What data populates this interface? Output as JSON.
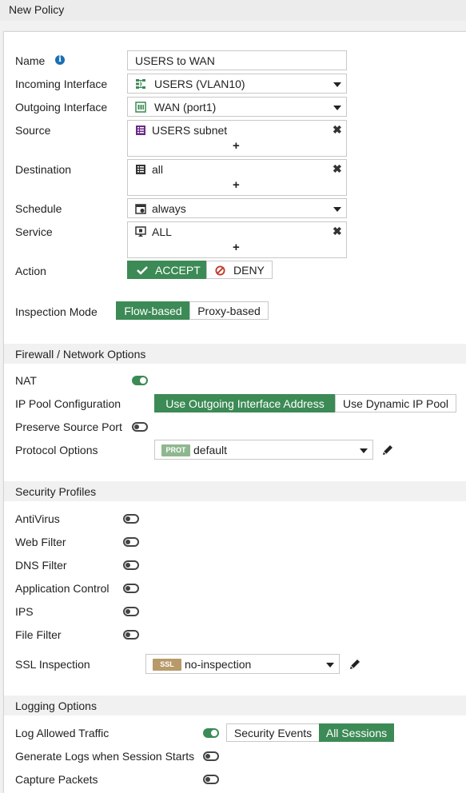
{
  "window": {
    "title": "New Policy"
  },
  "form": {
    "name": {
      "label": "Name",
      "value": "USERS to WAN"
    },
    "incoming": {
      "label": "Incoming Interface",
      "value": "USERS (VLAN10)"
    },
    "outgoing": {
      "label": "Outgoing Interface",
      "value": "WAN (port1)"
    },
    "source": {
      "label": "Source",
      "value": "USERS subnet",
      "add": "+"
    },
    "destination": {
      "label": "Destination",
      "value": "all",
      "add": "+"
    },
    "schedule": {
      "label": "Schedule",
      "value": "always"
    },
    "service": {
      "label": "Service",
      "value": "ALL",
      "add": "+"
    },
    "action": {
      "label": "Action",
      "accept": "ACCEPT",
      "deny": "DENY",
      "selected": "ACCEPT"
    },
    "inspection": {
      "label": "Inspection Mode",
      "flow": "Flow-based",
      "proxy": "Proxy-based",
      "selected": "Flow-based"
    }
  },
  "firewall": {
    "header": "Firewall / Network Options",
    "nat": {
      "label": "NAT",
      "enabled": true
    },
    "ippool": {
      "label": "IP Pool Configuration",
      "outgoing": "Use Outgoing Interface Address",
      "dynamic": "Use Dynamic IP Pool",
      "selected": "outgoing"
    },
    "preserve": {
      "label": "Preserve Source Port",
      "enabled": false
    },
    "protocol": {
      "label": "Protocol Options",
      "badge": "PROT",
      "value": "default"
    }
  },
  "security": {
    "header": "Security Profiles",
    "antivirus": {
      "label": "AntiVirus",
      "enabled": false
    },
    "webfilter": {
      "label": "Web Filter",
      "enabled": false
    },
    "dnsfilter": {
      "label": "DNS Filter",
      "enabled": false
    },
    "appcontrol": {
      "label": "Application Control",
      "enabled": false
    },
    "ips": {
      "label": "IPS",
      "enabled": false
    },
    "filefilter": {
      "label": "File Filter",
      "enabled": false
    },
    "ssl": {
      "label": "SSL Inspection",
      "badge": "SSL",
      "value": "no-inspection"
    }
  },
  "logging": {
    "header": "Logging Options",
    "allowed": {
      "label": "Log Allowed Traffic",
      "enabled": true,
      "security_events": "Security Events",
      "all_sessions": "All Sessions",
      "selected": "All Sessions"
    },
    "session_start": {
      "label": "Generate Logs when Session Starts",
      "enabled": false
    },
    "capture": {
      "label": "Capture Packets",
      "enabled": false
    }
  },
  "colors": {
    "accent": "#3c8a55",
    "deny": "#c0392b",
    "info": "#1a6fb4",
    "prot_badge": "#8fb78f",
    "ssl_badge": "#b89a6a"
  },
  "icons": [
    "info-icon",
    "interface-icon",
    "wan-port-icon",
    "address-icon",
    "schedule-icon",
    "service-icon",
    "check-icon",
    "deny-icon",
    "pencil-icon",
    "close-icon",
    "chevron-down-icon"
  ]
}
